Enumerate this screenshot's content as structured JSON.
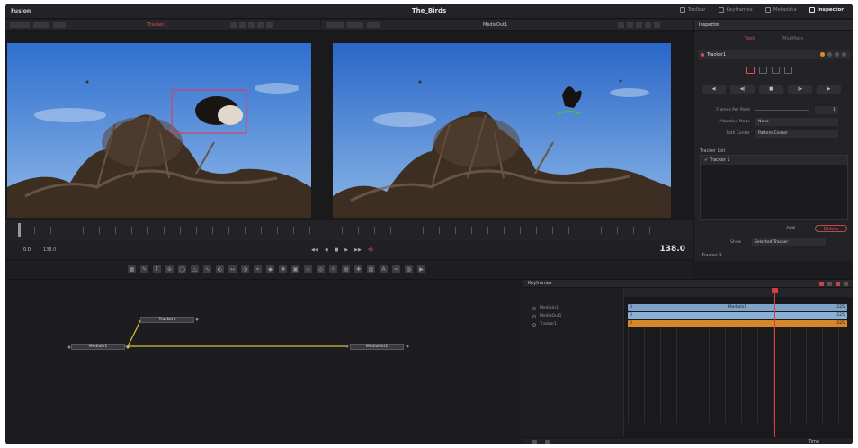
{
  "app": {
    "name": "Fusion",
    "project_title": "The_Birds"
  },
  "top_tabs": [
    {
      "label": "Toolbar",
      "active": false
    },
    {
      "label": "Keyframes",
      "active": false
    },
    {
      "label": "Metadata",
      "active": false
    },
    {
      "label": "Inspector",
      "active": true
    }
  ],
  "viewers": {
    "left": {
      "name": "Tracker1",
      "zoom": "Fit"
    },
    "right": {
      "name": "MediaOut1",
      "zoom": "Fit"
    }
  },
  "transport": {
    "in_label": "0.0",
    "out_label": "138.0",
    "controls": [
      "◀◀",
      "◀",
      "■",
      "▶",
      "▶▶"
    ],
    "frame_count": "138.0"
  },
  "inspector": {
    "title": "Inspector",
    "tabs": [
      {
        "label": "Tools",
        "active": true
      },
      {
        "label": "Modifiers",
        "active": false
      }
    ],
    "node_name": "Tracker1",
    "track_buttons": [
      "◀",
      "◀|",
      "■",
      "|▶",
      "▶"
    ],
    "props": [
      {
        "label": "Frames Per Point",
        "value": "1"
      },
      {
        "label": "Adaptive Mode",
        "value": "None"
      },
      {
        "label": "Path Center",
        "value": "Pattern Center"
      }
    ],
    "tracker_list_label": "Tracker List",
    "tracker_item": "Tracker 1",
    "add_button": "Add",
    "delete_button": "Delete",
    "show_label": "Show",
    "show_value": "Selected Tracker",
    "footer_label": "Tracker 1"
  },
  "nodes": {
    "tracker": "Tracker1",
    "media_in": "MediaIn1",
    "media_out": "MediaOut1"
  },
  "keyframes": {
    "title": "Keyframes",
    "items": [
      "MediaIn1",
      "MediaOut1",
      "Tracker1"
    ],
    "bars": [
      {
        "label": "MediaIn1",
        "start": "0",
        "end": "225",
        "color": "#7fa2c8"
      },
      {
        "label": "",
        "start": "0",
        "end": "225",
        "color": "#8ab0d6"
      },
      {
        "label": "",
        "start": "0",
        "end": "225",
        "color": "#d8862a"
      }
    ],
    "time_label": "Time"
  }
}
